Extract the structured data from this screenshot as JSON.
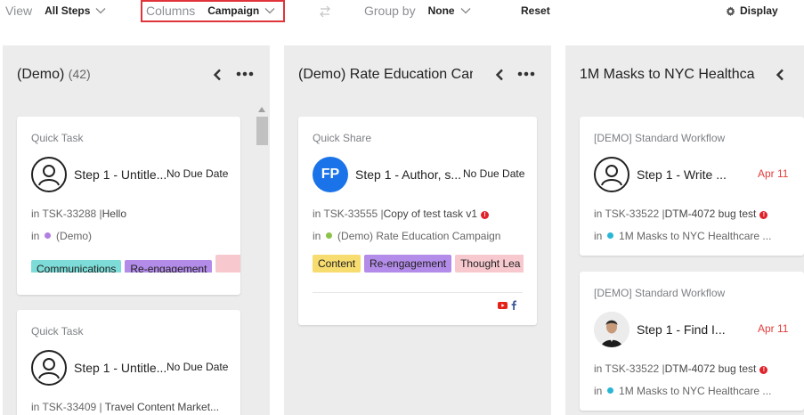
{
  "toolbar": {
    "view_label": "View",
    "view_value": "All Steps",
    "columns_label": "Columns",
    "columns_value": "Campaign",
    "groupby_label": "Group by",
    "groupby_value": "None",
    "reset_label": "Reset",
    "display_label": "Display"
  },
  "columns": [
    {
      "title": "(Demo)",
      "count": "(42)",
      "cards": [
        {
          "type": "Quick Task",
          "step": "Step 1 - Untitle...",
          "due": "No Due Date",
          "in1": "in",
          "task_id": "TSK-33288",
          "task_name": "Hello",
          "in2": "in",
          "campaign": "(Demo)",
          "tags": [
            "Communications",
            "Re-engagement",
            ""
          ]
        },
        {
          "type": "Quick Task",
          "step": "Step 1 - Untitle...",
          "due": "No Due Date",
          "in1": "in",
          "task_id": "TSK-33409",
          "task_name": "Travel Content Market..."
        }
      ]
    },
    {
      "title": "(Demo) Rate Education Can",
      "cards": [
        {
          "type": "Quick Share",
          "avatar_initials": "FP",
          "step": "Step 1 - Author, s...",
          "due": "No Due Date",
          "in1": "in",
          "task_id": "TSK-33555",
          "task_name": "Copy of test task v1",
          "alert": "!",
          "in2": "in",
          "campaign": "(Demo) Rate Education Campaign",
          "tags": [
            "Content",
            "Re-engagement",
            "Thought Lea"
          ]
        }
      ]
    },
    {
      "title": "1M Masks to NYC Healthca",
      "cards": [
        {
          "type": "[DEMO] Standard Workflow",
          "step": "Step 1 - Write ...",
          "due": "Apr 11",
          "in1": "in",
          "task_id": "TSK-33522",
          "task_name": "DTM-4072 bug test",
          "alert": "!",
          "in2": "in",
          "campaign": "1M Masks to NYC Healthcare ..."
        },
        {
          "type": "[DEMO] Standard Workflow",
          "step": "Step 1 - Find I...",
          "due": "Apr 11",
          "in1": "in",
          "task_id": "TSK-33522",
          "task_name": "DTM-4072 bug test",
          "alert": "!",
          "in2": "in",
          "campaign": "1M Masks to NYC Healthcare ..."
        }
      ]
    }
  ],
  "colors": {
    "highlight_border": "#e0343a",
    "column_bg": "#ececec",
    "demo_dot": "#b07fe0",
    "rate_dot": "#8bc34a",
    "masks_dot": "#29b6d6",
    "due_overdue": "#e23d3d"
  }
}
